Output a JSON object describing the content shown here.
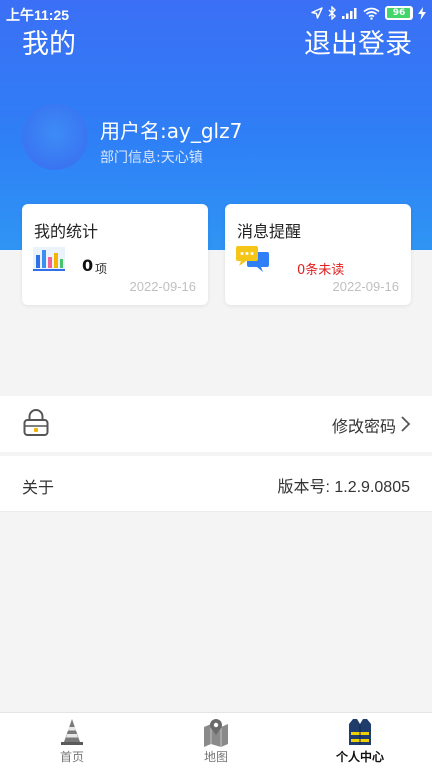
{
  "status_bar": {
    "time": "上午11:25",
    "battery": "96"
  },
  "header": {
    "title": "我的",
    "logout_label": "退出登录"
  },
  "profile": {
    "username": "用户名:ay_glz7",
    "department": "部门信息:天心镇"
  },
  "cards": {
    "stats": {
      "title": "我的统计",
      "value": "0",
      "unit": "项",
      "date": "2022-09-16",
      "icon": "bar-chart-icon"
    },
    "messages": {
      "title": "消息提醒",
      "unread": "0条未读",
      "date": "2022-09-16",
      "icon": "chat-bubbles-icon"
    }
  },
  "settings": {
    "change_password_label": "修改密码",
    "about_label": "关于",
    "version_label": "版本号: 1.2.9.0805"
  },
  "tabbar": {
    "items": [
      {
        "label": "首页",
        "icon": "traffic-cone-icon"
      },
      {
        "label": "地图",
        "icon": "map-icon"
      },
      {
        "label": "个人中心",
        "icon": "vest-icon"
      }
    ],
    "active": "个人中心"
  },
  "colors": {
    "header_start": "#3b6ff5",
    "header_end": "#2f95f4",
    "unread": "#e02020",
    "accent": "#2f7ff6"
  }
}
